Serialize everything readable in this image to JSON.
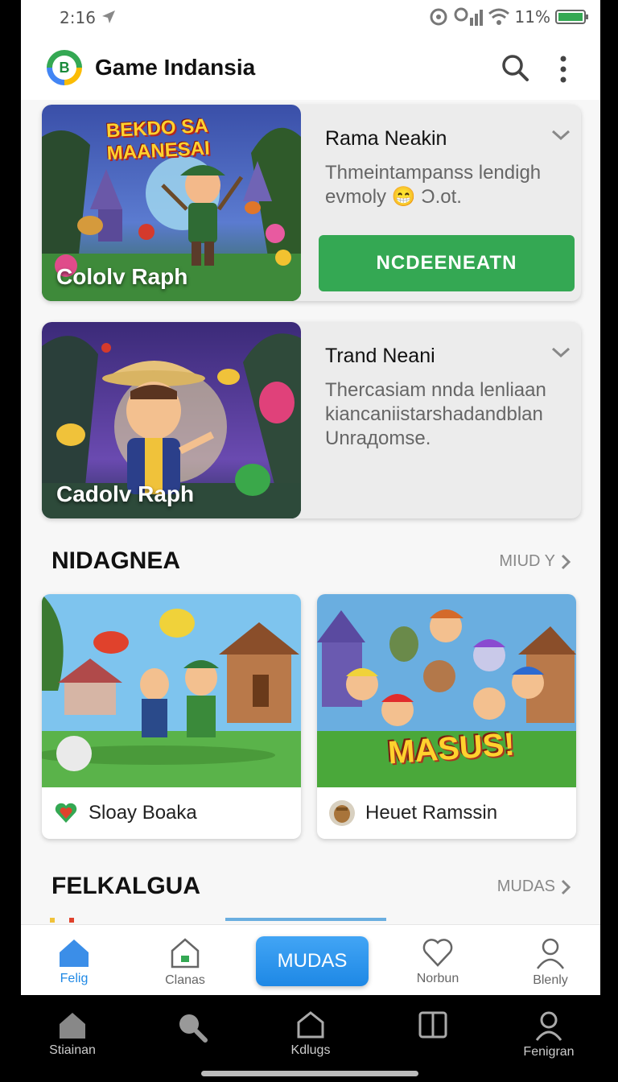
{
  "status": {
    "time": "2:16",
    "battery": "11%"
  },
  "app": {
    "title": "Game Indansia"
  },
  "featured": [
    {
      "image_banner_line1": "BEKDO SA",
      "image_banner_line2": "MAANESAI",
      "image_caption": "Cololv Raph",
      "title": "Rama Neakin",
      "description": "Thmeintampanss lendigh evmoly 😁 Ɔ.ot.",
      "cta": "NCDEENEATN"
    },
    {
      "image_caption": "Cadolv Raph",
      "title": "Trand Neani",
      "description": "Thercasiam nnda lenliaan kiancaniistarshadandblan Unrадomse."
    }
  ],
  "section1": {
    "title": "NIDAGNEA",
    "link": "MIUD Y",
    "games": [
      {
        "name": "Sloay Boaka",
        "icon": "heart-icon"
      },
      {
        "name": "Heuet Ramssin",
        "icon": "avatar-icon",
        "image_text": "MASUS!"
      }
    ]
  },
  "section2": {
    "title": "FELKALGUA",
    "link": "MUDAS"
  },
  "tabs": [
    {
      "label": "Felig",
      "icon": "home-icon",
      "active": true
    },
    {
      "label": "Clanas",
      "icon": "store-icon",
      "active": false
    },
    {
      "label": "MUDAS",
      "icon": "",
      "active": false
    },
    {
      "label": "Norbun",
      "icon": "heart-icon",
      "active": false
    },
    {
      "label": "Blenly",
      "icon": "person-icon",
      "active": false
    }
  ],
  "system_nav": [
    {
      "label": "Stiainan",
      "icon": "home-icon"
    },
    {
      "label": "",
      "icon": "search-icon"
    },
    {
      "label": "Kdlugs",
      "icon": "shield-icon"
    },
    {
      "label": "",
      "icon": "book-icon"
    },
    {
      "label": "Fenigran",
      "icon": "person-icon"
    }
  ],
  "colors": {
    "accent_green": "#34a853",
    "accent_blue": "#1e88e5"
  }
}
